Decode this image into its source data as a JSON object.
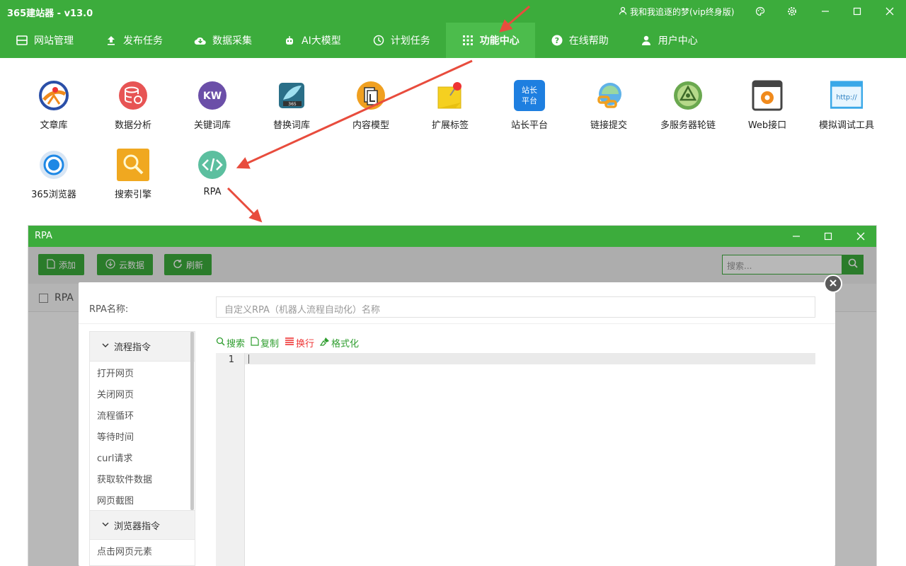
{
  "app": {
    "title": "365建站器 - v13.0",
    "user": "我和我追逐的梦(vip终身版)"
  },
  "nav": [
    {
      "label": "网站管理",
      "icon": "window-icon"
    },
    {
      "label": "发布任务",
      "icon": "upload-icon"
    },
    {
      "label": "数据采集",
      "icon": "cloud-download-icon"
    },
    {
      "label": "AI大模型",
      "icon": "robot-icon"
    },
    {
      "label": "计划任务",
      "icon": "clock-icon"
    },
    {
      "label": "功能中心",
      "icon": "grid-icon",
      "active": true
    },
    {
      "label": "在线帮助",
      "icon": "help-icon"
    },
    {
      "label": "用户中心",
      "icon": "user-icon"
    }
  ],
  "features": [
    {
      "label": "文章库"
    },
    {
      "label": "数据分析"
    },
    {
      "label": "关键词库",
      "badge": "KW"
    },
    {
      "label": "替换词库",
      "badge": "365"
    },
    {
      "label": "内容模型"
    },
    {
      "label": "扩展标签"
    },
    {
      "label": "站长平台",
      "badge": "站长\n平台"
    },
    {
      "label": "链接提交"
    },
    {
      "label": "多服务器轮链"
    },
    {
      "label": "Web接口"
    },
    {
      "label": "模拟调试工具",
      "badge": "http://"
    },
    {
      "label": "365浏览器"
    },
    {
      "label": "搜索引擎"
    },
    {
      "label": "RPA"
    }
  ],
  "rpa_window": {
    "title": "RPA",
    "buttons": {
      "add": "添加",
      "cloud": "云数据",
      "refresh": "刷新"
    },
    "search_placeholder": "搜索...",
    "list_header": "RPA"
  },
  "dialog": {
    "name_label": "RPA名称:",
    "name_placeholder": "自定义RPA（机器人流程自动化）名称",
    "tools": {
      "search": "搜索",
      "copy": "复制",
      "wrap": "换行",
      "format": "格式化"
    },
    "line_number": "1",
    "groups": [
      {
        "title": "流程指令",
        "items": [
          "打开网页",
          "关闭网页",
          "流程循环",
          "等待时间",
          "curl请求",
          "获取软件数据",
          "网页截图"
        ]
      },
      {
        "title": "浏览器指令",
        "items": [
          "点击网页元素"
        ]
      }
    ]
  },
  "colors": {
    "brand": "#3cac3c",
    "arrow": "#e84c3d"
  }
}
